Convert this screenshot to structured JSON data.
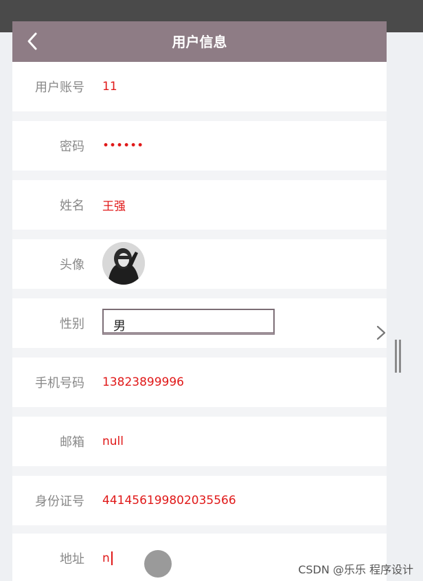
{
  "header": {
    "title": "用户信息"
  },
  "form": {
    "account": {
      "label": "用户账号",
      "value": "11"
    },
    "password": {
      "label": "密码",
      "value": "••••••"
    },
    "name": {
      "label": "姓名",
      "value": "王强"
    },
    "avatar": {
      "label": "头像"
    },
    "gender": {
      "label": "性别",
      "value": "男"
    },
    "phone": {
      "label": "手机号码",
      "value": "13823899996"
    },
    "email": {
      "label": "邮箱",
      "value": "null"
    },
    "id_card": {
      "label": "身份证号",
      "value": "441456199802035566"
    },
    "address": {
      "label": "地址",
      "value": "n"
    }
  },
  "watermark": "CSDN @乐乐 程序设计",
  "colors": {
    "header_bg": "#8e7c85",
    "value_text": "#e01818",
    "label_text": "#888888"
  },
  "icons": {
    "back": "chevron-left-icon",
    "side": "chevron-right-icon",
    "scroll": "scroll-handle-icon"
  }
}
